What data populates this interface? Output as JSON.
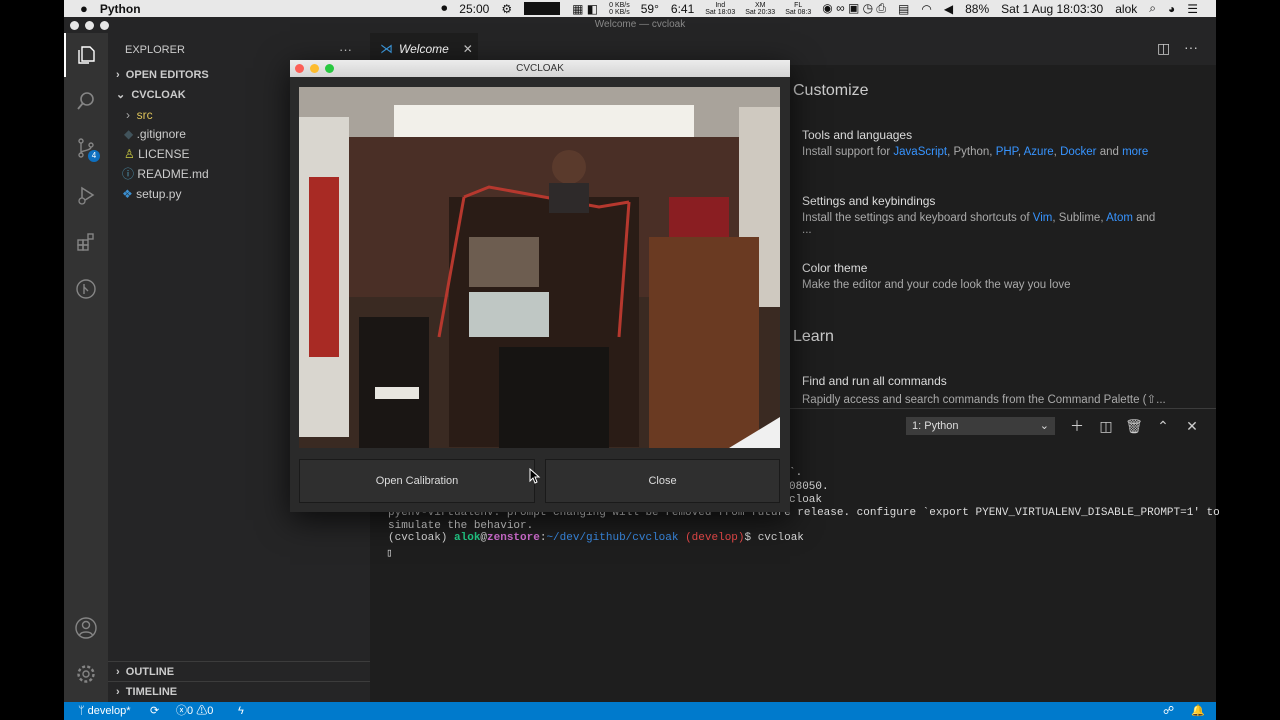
{
  "menubar": {
    "apple_icon": "apple-icon",
    "app_name": "Python",
    "clock_label": "25:00",
    "battery_time": "6:41",
    "world_clocks": [
      {
        "name": "Ind",
        "time": "Sat 18:03"
      },
      {
        "name": "XM",
        "time": "Sat 20:33"
      },
      {
        "name": "FL",
        "time": "Sat 08:3"
      }
    ],
    "net_up": "0 KB/s",
    "net_down": "0 KB/s",
    "temperature": "59°",
    "battery_percent": "88%",
    "datetime": "Sat 1 Aug  18:03:30",
    "user": "alok"
  },
  "window_title": "Welcome — cvcloak",
  "sidebar": {
    "header": "EXPLORER",
    "more": "···",
    "open_editors": "OPEN EDITORS",
    "project": "CVCLOAK",
    "files": [
      {
        "name": "src",
        "kind": "folder"
      },
      {
        "name": ".gitignore",
        "kind": "file"
      },
      {
        "name": "LICENSE",
        "kind": "file"
      },
      {
        "name": "README.md",
        "kind": "file"
      },
      {
        "name": "setup.py",
        "kind": "file"
      }
    ],
    "outline": "OUTLINE",
    "timeline": "TIMELINE",
    "scm_badge": "4"
  },
  "tab": {
    "label": "Welcome"
  },
  "welcome": {
    "customize_heading": "Customize",
    "learn_heading": "Learn",
    "tools": {
      "title": "Tools and languages",
      "prefix": "Install support for ",
      "js": "JavaScript",
      "python": ", Python, ",
      "php": "PHP",
      "sep": ", ",
      "azure": "Azure",
      "docker": "Docker",
      "and": " and ",
      "more": "more"
    },
    "settings": {
      "title": "Settings and keybindings",
      "prefix": "Install the settings and keyboard shortcuts of ",
      "vim": "Vim",
      "sublime": ", Sublime, ",
      "atom": "Atom",
      "tail": " and ..."
    },
    "color": {
      "title": "Color theme",
      "desc": "Make the editor and your code look the way you love"
    },
    "commands": {
      "title": "Find and run all commands",
      "desc": "Rapidly access and search commands from the Command Palette (⇧..."
    }
  },
  "terminal": {
    "selector": "1: Python",
    "line0": "`.",
    "line1": "08050.",
    "line2": "cloak",
    "line3": "pyenv-virtualenv: prompt changing will be removed from future release. configure `export PYENV_VIRTUALENV_DISABLE_PROMPT=1' to",
    "line4": "simulate the behavior.",
    "prompt_env": "(cvcloak) ",
    "prompt_user": "alok",
    "prompt_at": "@",
    "prompt_host": "zenstore",
    "prompt_sep": ":",
    "prompt_path": "~/dev/github/cvcloak",
    "prompt_branch": " (develop)",
    "prompt_cmd": "$ cvcloak",
    "cursor": "▯"
  },
  "cv_window": {
    "title": "CVCLOAK",
    "open_calibration": "Open Calibration",
    "close": "Close"
  },
  "statusbar": {
    "branch": "develop*",
    "errors": "0",
    "warnings": "0"
  }
}
